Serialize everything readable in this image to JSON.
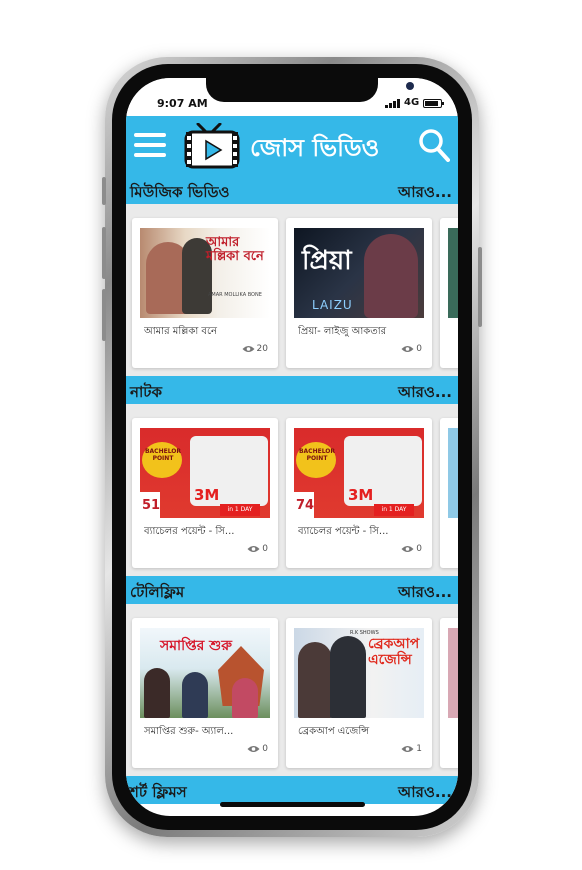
{
  "status": {
    "time": "9:07 AM",
    "network": "4G"
  },
  "app": {
    "title": "জোস ভিডিও",
    "accent": "#35b8e8"
  },
  "icons": {
    "menu": "menu-icon",
    "logo": "tv-play-icon",
    "search": "search-icon",
    "views": "eye-icon"
  },
  "sections": [
    {
      "title": "মিউজিক ভিডিও",
      "more": "আরও...",
      "cards": [
        {
          "title": "আমার মল্লিকা বনে",
          "views": "20"
        },
        {
          "title": "প্রিয়া- লাইজু আকতার",
          "views": "0"
        }
      ]
    },
    {
      "title": "নাটক",
      "more": "আরও...",
      "cards": [
        {
          "title": "ব্যাচেলর পয়েন্ট - সি...",
          "views": "0"
        },
        {
          "title": "ব্যাচেলর পয়েন্ট - সি...",
          "views": "0"
        }
      ]
    },
    {
      "title": "টেলিফ্লিম",
      "more": "আরও...",
      "cards": [
        {
          "title": "সমাপ্তির শুরু- অ্যাল...",
          "views": "0"
        },
        {
          "title": "ব্রেকআপ এজেন্সি",
          "views": "1"
        }
      ]
    },
    {
      "title": "শর্ট ফ্লিমস",
      "more": "আরও..."
    }
  ],
  "thumbnails": [
    {
      "overlay": "আমার মল্লিকা বনে",
      "sub": "AMAR MOLLIKA BONE"
    },
    {
      "overlay": "প্রিয়া",
      "sub": "LAIZU"
    },
    {
      "overlay": "BACHELOR POINT",
      "episode": "51",
      "badge": "3M",
      "badge_sub": "in 1 DAY"
    },
    {
      "overlay": "BACHELOR POINT",
      "episode": "74",
      "badge": "3M",
      "badge_sub": "in 1 DAY"
    },
    {
      "overlay": "সমাপ্তির শুরু"
    },
    {
      "overlay": "ব্রেকআপ এজেন্সি",
      "sub": "R.K SHOWS"
    }
  ]
}
